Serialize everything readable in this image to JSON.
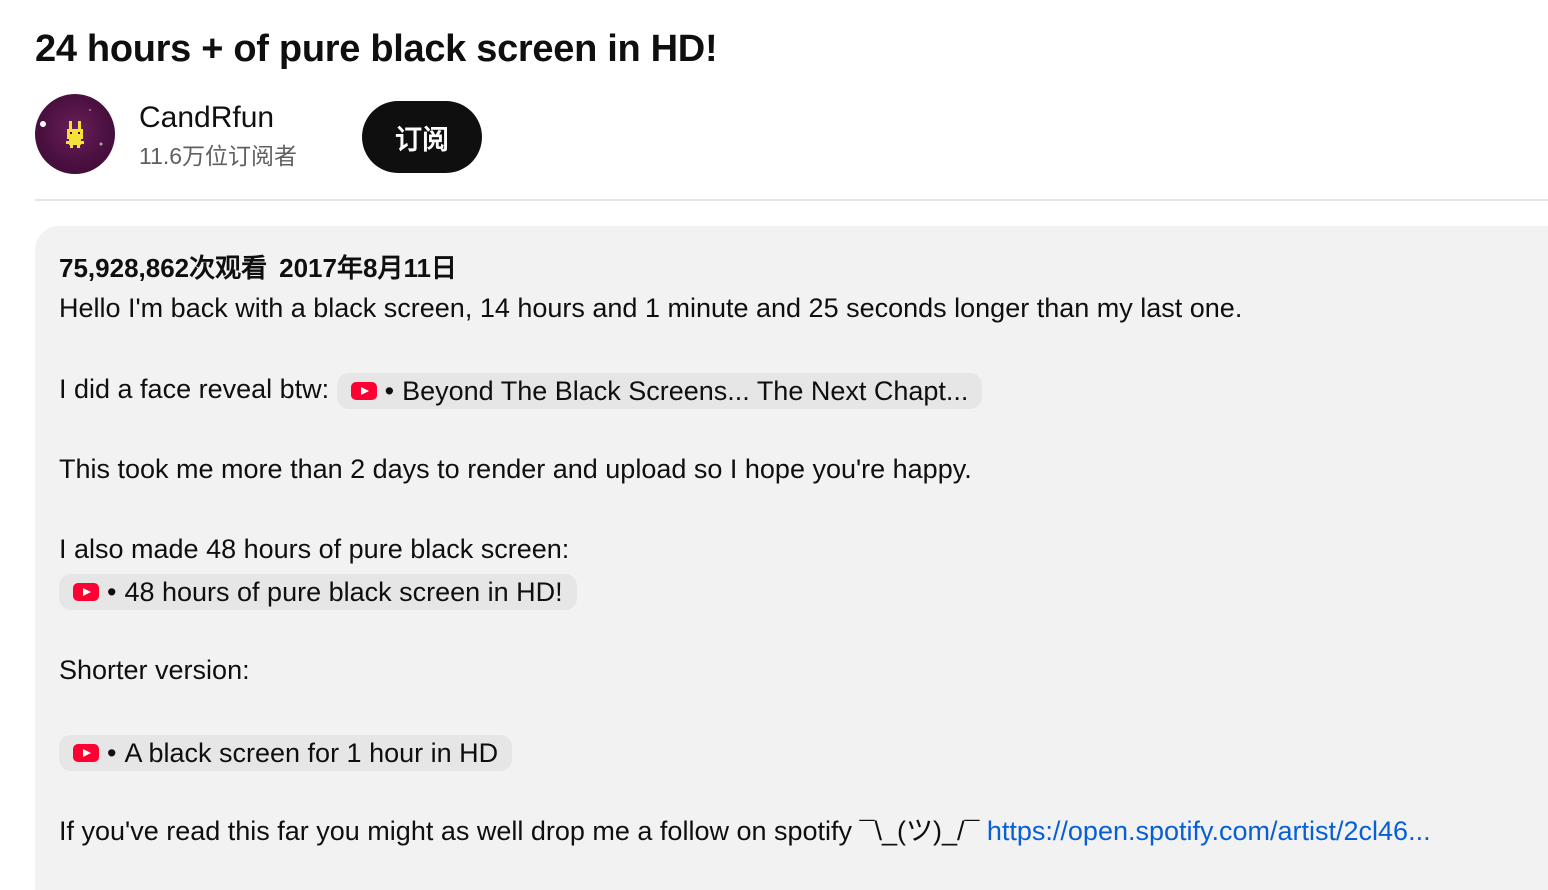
{
  "video": {
    "title": "24 hours + of pure black screen in HD!"
  },
  "channel": {
    "name": "CandRfun",
    "subscribers": "11.6万位订阅者",
    "subscribe_label": "订阅",
    "avatar_icon": "pixel-bunny-avatar-icon"
  },
  "description": {
    "views": "75,928,862次观看",
    "date": "2017年8月11日",
    "line1": "Hello I'm back with a black screen, 14 hours and 1 minute and 25 seconds longer than my last one.",
    "face_reveal_prefix": "I did a face reveal btw: ",
    "chip_separator": "•",
    "face_reveal_chip": "Beyond The Black Screens... The Next Chapt...",
    "line3": "This took me more than 2 days to render and upload so I hope you're happy.",
    "line4": "I also made 48 hours of pure black screen:",
    "chip_48": "48 hours of pure black screen in HD!",
    "shorter": "Shorter version:",
    "chip_1h": "A black screen for 1 hour in HD",
    "spotify_prefix": "If you've read this far you might as well drop me a follow on spotify ¯\\_(ツ)_/¯ ",
    "spotify_link": "https://open.spotify.com/artist/2cl46..."
  },
  "colors": {
    "accent_link": "#065fd4",
    "youtube_red": "#ff0033",
    "subscribe_bg": "#0f0f0f",
    "description_bg": "#f2f2f2"
  }
}
